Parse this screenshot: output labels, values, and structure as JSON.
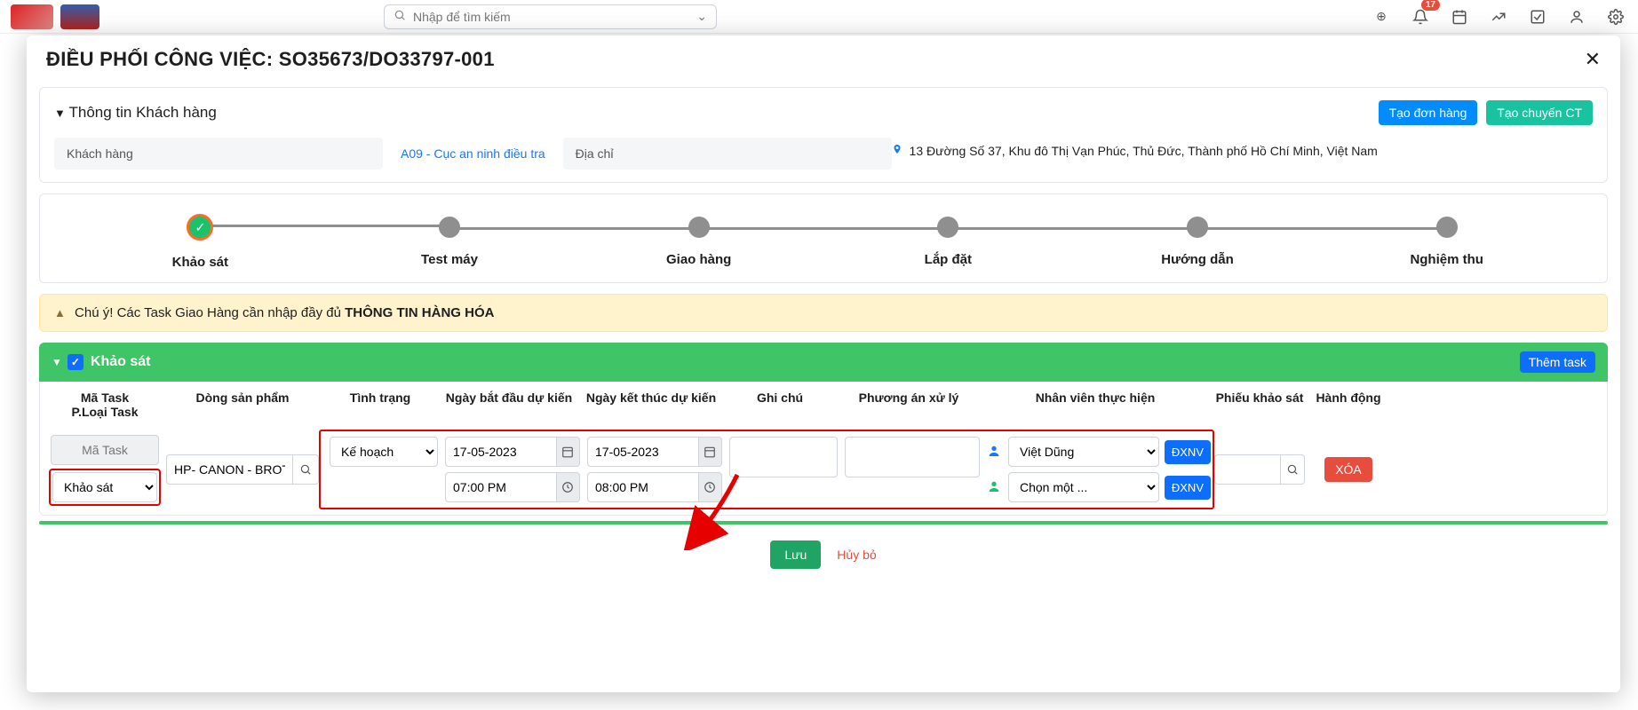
{
  "topbar": {
    "search_placeholder": "Nhập để tìm kiếm",
    "notif_count": "17"
  },
  "modal": {
    "title": "ĐIỀU PHỐI CÔNG VIỆC: SO35673/DO33797-001"
  },
  "customerSection": {
    "heading": "Thông tin Khách hàng",
    "btn_create_order": "Tạo đơn hàng",
    "btn_create_ct": "Tạo chuyến CT",
    "customer_label": "Khách hàng",
    "customer_value": "A09 - Cục an ninh điều tra",
    "address_label": "Địa chỉ",
    "address_value": "13 Đường Số 37, Khu đô Thị Vạn Phúc, Thủ Đức, Thành phố Hồ Chí Minh, Việt Nam"
  },
  "steps": [
    "Khảo sát",
    "Test máy",
    "Giao hàng",
    "Lắp đặt",
    "Hướng dẫn",
    "Nghiệm thu"
  ],
  "alert": {
    "prefix": "Chú ý! Các Task Giao Hàng cần nhập đầy đủ ",
    "bold": "THÔNG TIN HÀNG HÓA"
  },
  "taskSection": {
    "title": "Khảo sát",
    "btn_add": "Thêm task",
    "columns": {
      "code": "Mã Task",
      "ptype": "P.Loại Task",
      "product": "Dòng sản phẩm",
      "status": "Tình trạng",
      "start": "Ngày bắt đầu dự kiến",
      "end": "Ngày kết thúc dự kiến",
      "note": "Ghi chú",
      "plan": "Phương án xử lý",
      "staff": "Nhân viên thực hiện",
      "survey": "Phiếu khảo sát",
      "action": "Hành động"
    },
    "row": {
      "code_placeholder": "Mã Task",
      "ptype_value": "Khảo sát",
      "product_value": "HP- CANON - BROTHER",
      "status_value": "Kế hoạch",
      "start_date": "17-05-2023",
      "start_time": "07:00 PM",
      "end_date": "17-05-2023",
      "end_time": "08:00 PM",
      "staff1": "Việt Dũng",
      "staff2_placeholder": "Chọn một ...",
      "btn_dxnv": "ĐXNV",
      "btn_delete": "XÓA"
    }
  },
  "footer": {
    "save": "Lưu",
    "cancel": "Hủy bỏ"
  }
}
